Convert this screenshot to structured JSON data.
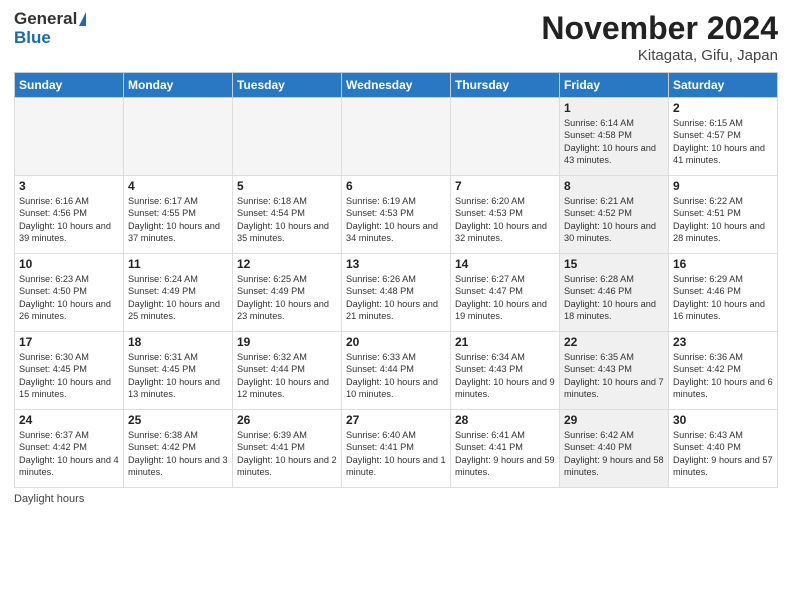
{
  "header": {
    "logo_general": "General",
    "logo_blue": "Blue",
    "month_title": "November 2024",
    "location": "Kitagata, Gifu, Japan"
  },
  "days_of_week": [
    "Sunday",
    "Monday",
    "Tuesday",
    "Wednesday",
    "Thursday",
    "Friday",
    "Saturday"
  ],
  "weeks": [
    [
      {
        "day": "",
        "info": "",
        "empty": true
      },
      {
        "day": "",
        "info": "",
        "empty": true
      },
      {
        "day": "",
        "info": "",
        "empty": true
      },
      {
        "day": "",
        "info": "",
        "empty": true
      },
      {
        "day": "",
        "info": "",
        "empty": true
      },
      {
        "day": "1",
        "info": "Sunrise: 6:14 AM\nSunset: 4:58 PM\nDaylight: 10 hours\nand 43 minutes.",
        "shaded": true
      },
      {
        "day": "2",
        "info": "Sunrise: 6:15 AM\nSunset: 4:57 PM\nDaylight: 10 hours\nand 41 minutes.",
        "shaded": false
      }
    ],
    [
      {
        "day": "3",
        "info": "Sunrise: 6:16 AM\nSunset: 4:56 PM\nDaylight: 10 hours\nand 39 minutes.",
        "shaded": false
      },
      {
        "day": "4",
        "info": "Sunrise: 6:17 AM\nSunset: 4:55 PM\nDaylight: 10 hours\nand 37 minutes.",
        "shaded": false
      },
      {
        "day": "5",
        "info": "Sunrise: 6:18 AM\nSunset: 4:54 PM\nDaylight: 10 hours\nand 35 minutes.",
        "shaded": false
      },
      {
        "day": "6",
        "info": "Sunrise: 6:19 AM\nSunset: 4:53 PM\nDaylight: 10 hours\nand 34 minutes.",
        "shaded": false
      },
      {
        "day": "7",
        "info": "Sunrise: 6:20 AM\nSunset: 4:53 PM\nDaylight: 10 hours\nand 32 minutes.",
        "shaded": false
      },
      {
        "day": "8",
        "info": "Sunrise: 6:21 AM\nSunset: 4:52 PM\nDaylight: 10 hours\nand 30 minutes.",
        "shaded": true
      },
      {
        "day": "9",
        "info": "Sunrise: 6:22 AM\nSunset: 4:51 PM\nDaylight: 10 hours\nand 28 minutes.",
        "shaded": false
      }
    ],
    [
      {
        "day": "10",
        "info": "Sunrise: 6:23 AM\nSunset: 4:50 PM\nDaylight: 10 hours\nand 26 minutes.",
        "shaded": false
      },
      {
        "day": "11",
        "info": "Sunrise: 6:24 AM\nSunset: 4:49 PM\nDaylight: 10 hours\nand 25 minutes.",
        "shaded": false
      },
      {
        "day": "12",
        "info": "Sunrise: 6:25 AM\nSunset: 4:49 PM\nDaylight: 10 hours\nand 23 minutes.",
        "shaded": false
      },
      {
        "day": "13",
        "info": "Sunrise: 6:26 AM\nSunset: 4:48 PM\nDaylight: 10 hours\nand 21 minutes.",
        "shaded": false
      },
      {
        "day": "14",
        "info": "Sunrise: 6:27 AM\nSunset: 4:47 PM\nDaylight: 10 hours\nand 19 minutes.",
        "shaded": false
      },
      {
        "day": "15",
        "info": "Sunrise: 6:28 AM\nSunset: 4:46 PM\nDaylight: 10 hours\nand 18 minutes.",
        "shaded": true
      },
      {
        "day": "16",
        "info": "Sunrise: 6:29 AM\nSunset: 4:46 PM\nDaylight: 10 hours\nand 16 minutes.",
        "shaded": false
      }
    ],
    [
      {
        "day": "17",
        "info": "Sunrise: 6:30 AM\nSunset: 4:45 PM\nDaylight: 10 hours\nand 15 minutes.",
        "shaded": false
      },
      {
        "day": "18",
        "info": "Sunrise: 6:31 AM\nSunset: 4:45 PM\nDaylight: 10 hours\nand 13 minutes.",
        "shaded": false
      },
      {
        "day": "19",
        "info": "Sunrise: 6:32 AM\nSunset: 4:44 PM\nDaylight: 10 hours\nand 12 minutes.",
        "shaded": false
      },
      {
        "day": "20",
        "info": "Sunrise: 6:33 AM\nSunset: 4:44 PM\nDaylight: 10 hours\nand 10 minutes.",
        "shaded": false
      },
      {
        "day": "21",
        "info": "Sunrise: 6:34 AM\nSunset: 4:43 PM\nDaylight: 10 hours\nand 9 minutes.",
        "shaded": false
      },
      {
        "day": "22",
        "info": "Sunrise: 6:35 AM\nSunset: 4:43 PM\nDaylight: 10 hours\nand 7 minutes.",
        "shaded": true
      },
      {
        "day": "23",
        "info": "Sunrise: 6:36 AM\nSunset: 4:42 PM\nDaylight: 10 hours\nand 6 minutes.",
        "shaded": false
      }
    ],
    [
      {
        "day": "24",
        "info": "Sunrise: 6:37 AM\nSunset: 4:42 PM\nDaylight: 10 hours\nand 4 minutes.",
        "shaded": false
      },
      {
        "day": "25",
        "info": "Sunrise: 6:38 AM\nSunset: 4:42 PM\nDaylight: 10 hours\nand 3 minutes.",
        "shaded": false
      },
      {
        "day": "26",
        "info": "Sunrise: 6:39 AM\nSunset: 4:41 PM\nDaylight: 10 hours\nand 2 minutes.",
        "shaded": false
      },
      {
        "day": "27",
        "info": "Sunrise: 6:40 AM\nSunset: 4:41 PM\nDaylight: 10 hours\nand 1 minute.",
        "shaded": false
      },
      {
        "day": "28",
        "info": "Sunrise: 6:41 AM\nSunset: 4:41 PM\nDaylight: 9 hours\nand 59 minutes.",
        "shaded": false
      },
      {
        "day": "29",
        "info": "Sunrise: 6:42 AM\nSunset: 4:40 PM\nDaylight: 9 hours\nand 58 minutes.",
        "shaded": true
      },
      {
        "day": "30",
        "info": "Sunrise: 6:43 AM\nSunset: 4:40 PM\nDaylight: 9 hours\nand 57 minutes.",
        "shaded": false
      }
    ]
  ],
  "footer": {
    "daylight_label": "Daylight hours"
  }
}
